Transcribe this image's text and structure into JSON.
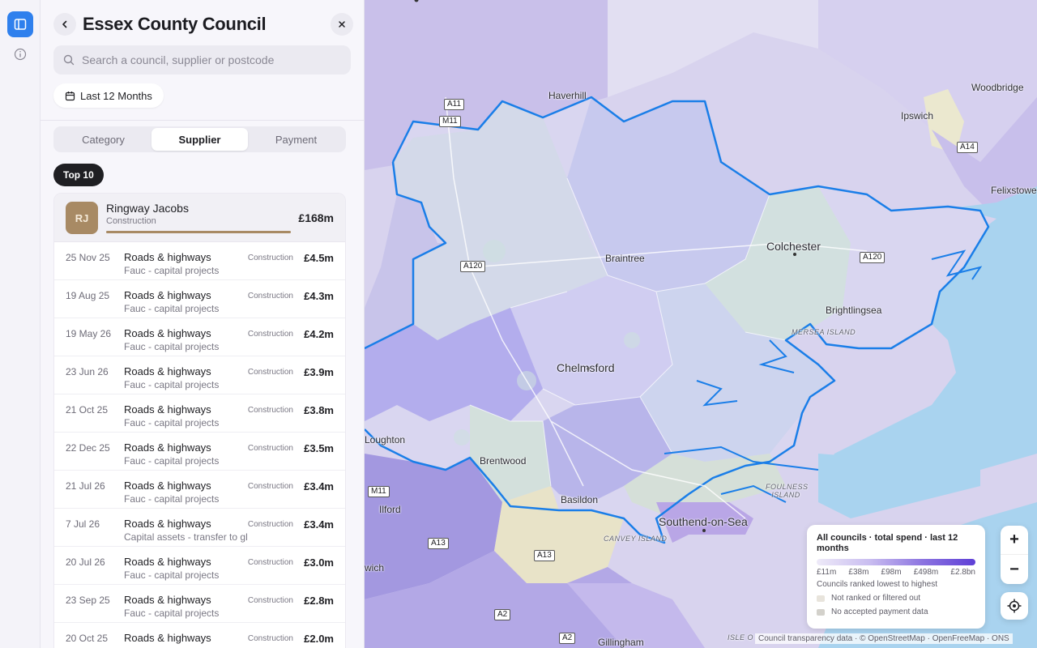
{
  "sidebar": {
    "title": "Essex County Council",
    "search_placeholder": "Search a council, supplier or postcode",
    "date_filter": "Last 12 Months",
    "tabs": [
      {
        "label": "Category",
        "active": false
      },
      {
        "label": "Supplier",
        "active": true
      },
      {
        "label": "Payment",
        "active": false
      }
    ],
    "top_label": "Top 10",
    "supplier": {
      "initials": "RJ",
      "name": "Ringway Jacobs",
      "category": "Construction",
      "amount": "£168m",
      "share": 1.0
    },
    "payments": [
      {
        "date": "25 Nov 25",
        "category": "Roads & highways",
        "description": "Fauc - capital projects",
        "tag": "Construction",
        "amount": "£4.5m"
      },
      {
        "date": "19 Aug 25",
        "category": "Roads & highways",
        "description": "Fauc - capital projects",
        "tag": "Construction",
        "amount": "£4.3m"
      },
      {
        "date": "19 May 26",
        "category": "Roads & highways",
        "description": "Fauc - capital projects",
        "tag": "Construction",
        "amount": "£4.2m"
      },
      {
        "date": "23 Jun 26",
        "category": "Roads & highways",
        "description": "Fauc - capital projects",
        "tag": "Construction",
        "amount": "£3.9m"
      },
      {
        "date": "21 Oct 25",
        "category": "Roads & highways",
        "description": "Fauc - capital projects",
        "tag": "Construction",
        "amount": "£3.8m"
      },
      {
        "date": "22 Dec 25",
        "category": "Roads & highways",
        "description": "Fauc - capital projects",
        "tag": "Construction",
        "amount": "£3.5m"
      },
      {
        "date": "21 Jul 26",
        "category": "Roads & highways",
        "description": "Fauc - capital projects",
        "tag": "Construction",
        "amount": "£3.4m"
      },
      {
        "date": "7 Jul 26",
        "category": "Roads & highways",
        "description": "Capital assets - transfer to gl",
        "tag": "Construction",
        "amount": "£3.4m"
      },
      {
        "date": "20 Jul 26",
        "category": "Roads & highways",
        "description": "Fauc - capital projects",
        "tag": "Construction",
        "amount": "£3.0m"
      },
      {
        "date": "23 Sep 25",
        "category": "Roads & highways",
        "description": "Fauc - capital projects",
        "tag": "Construction",
        "amount": "£2.8m"
      },
      {
        "date": "20 Oct 25",
        "category": "Roads & highways",
        "description": "",
        "tag": "Construction",
        "amount": "£2.0m"
      }
    ]
  },
  "map": {
    "places": {
      "haverhill": "Haverhill",
      "ipswich": "Ipswich",
      "woodbridge": "Woodbridge",
      "felixstowe": "Felixstowe",
      "braintree": "Braintree",
      "colchester": "Colchester",
      "brightlingsea": "Brightlingsea",
      "mersea": "MERSEA ISLAND",
      "chelmsford": "Chelmsford",
      "loughton": "Loughton",
      "brentwood": "Brentwood",
      "basildon": "Basildon",
      "ilford": "Ilford",
      "southend": "Southend-on-Sea",
      "canvey": "CANVEY ISLAND",
      "foulness": "FOULNESS ISLAND",
      "wich": "wich",
      "gillingham": "Gillingham",
      "isle": "ISLE O"
    },
    "roads": {
      "a11": "A11",
      "m11_top": "M11",
      "a120_left": "A120",
      "a120_right": "A120",
      "a14": "A14",
      "m11_bottom": "M11",
      "a13_left": "A13",
      "a13_right": "A13",
      "a2_left": "A2",
      "a2_right": "A2"
    },
    "legend": {
      "title": "All councils · total spend · last 12 months",
      "ticks": [
        "£11m",
        "£38m",
        "£98m",
        "£498m",
        "£2.8bn"
      ],
      "subtitle": "Councils ranked lowest to highest",
      "not_ranked": "Not ranked or filtered out",
      "no_data": "No accepted payment data"
    },
    "zoom_in": "+",
    "zoom_out": "−",
    "attribution": "Council transparency data · © OpenStreetMap · OpenFreeMap · ONS",
    "colors": {
      "highlight_boundary": "#1a7ee8",
      "sea": "#a9d3ef",
      "accent": "#2f80ed"
    }
  }
}
